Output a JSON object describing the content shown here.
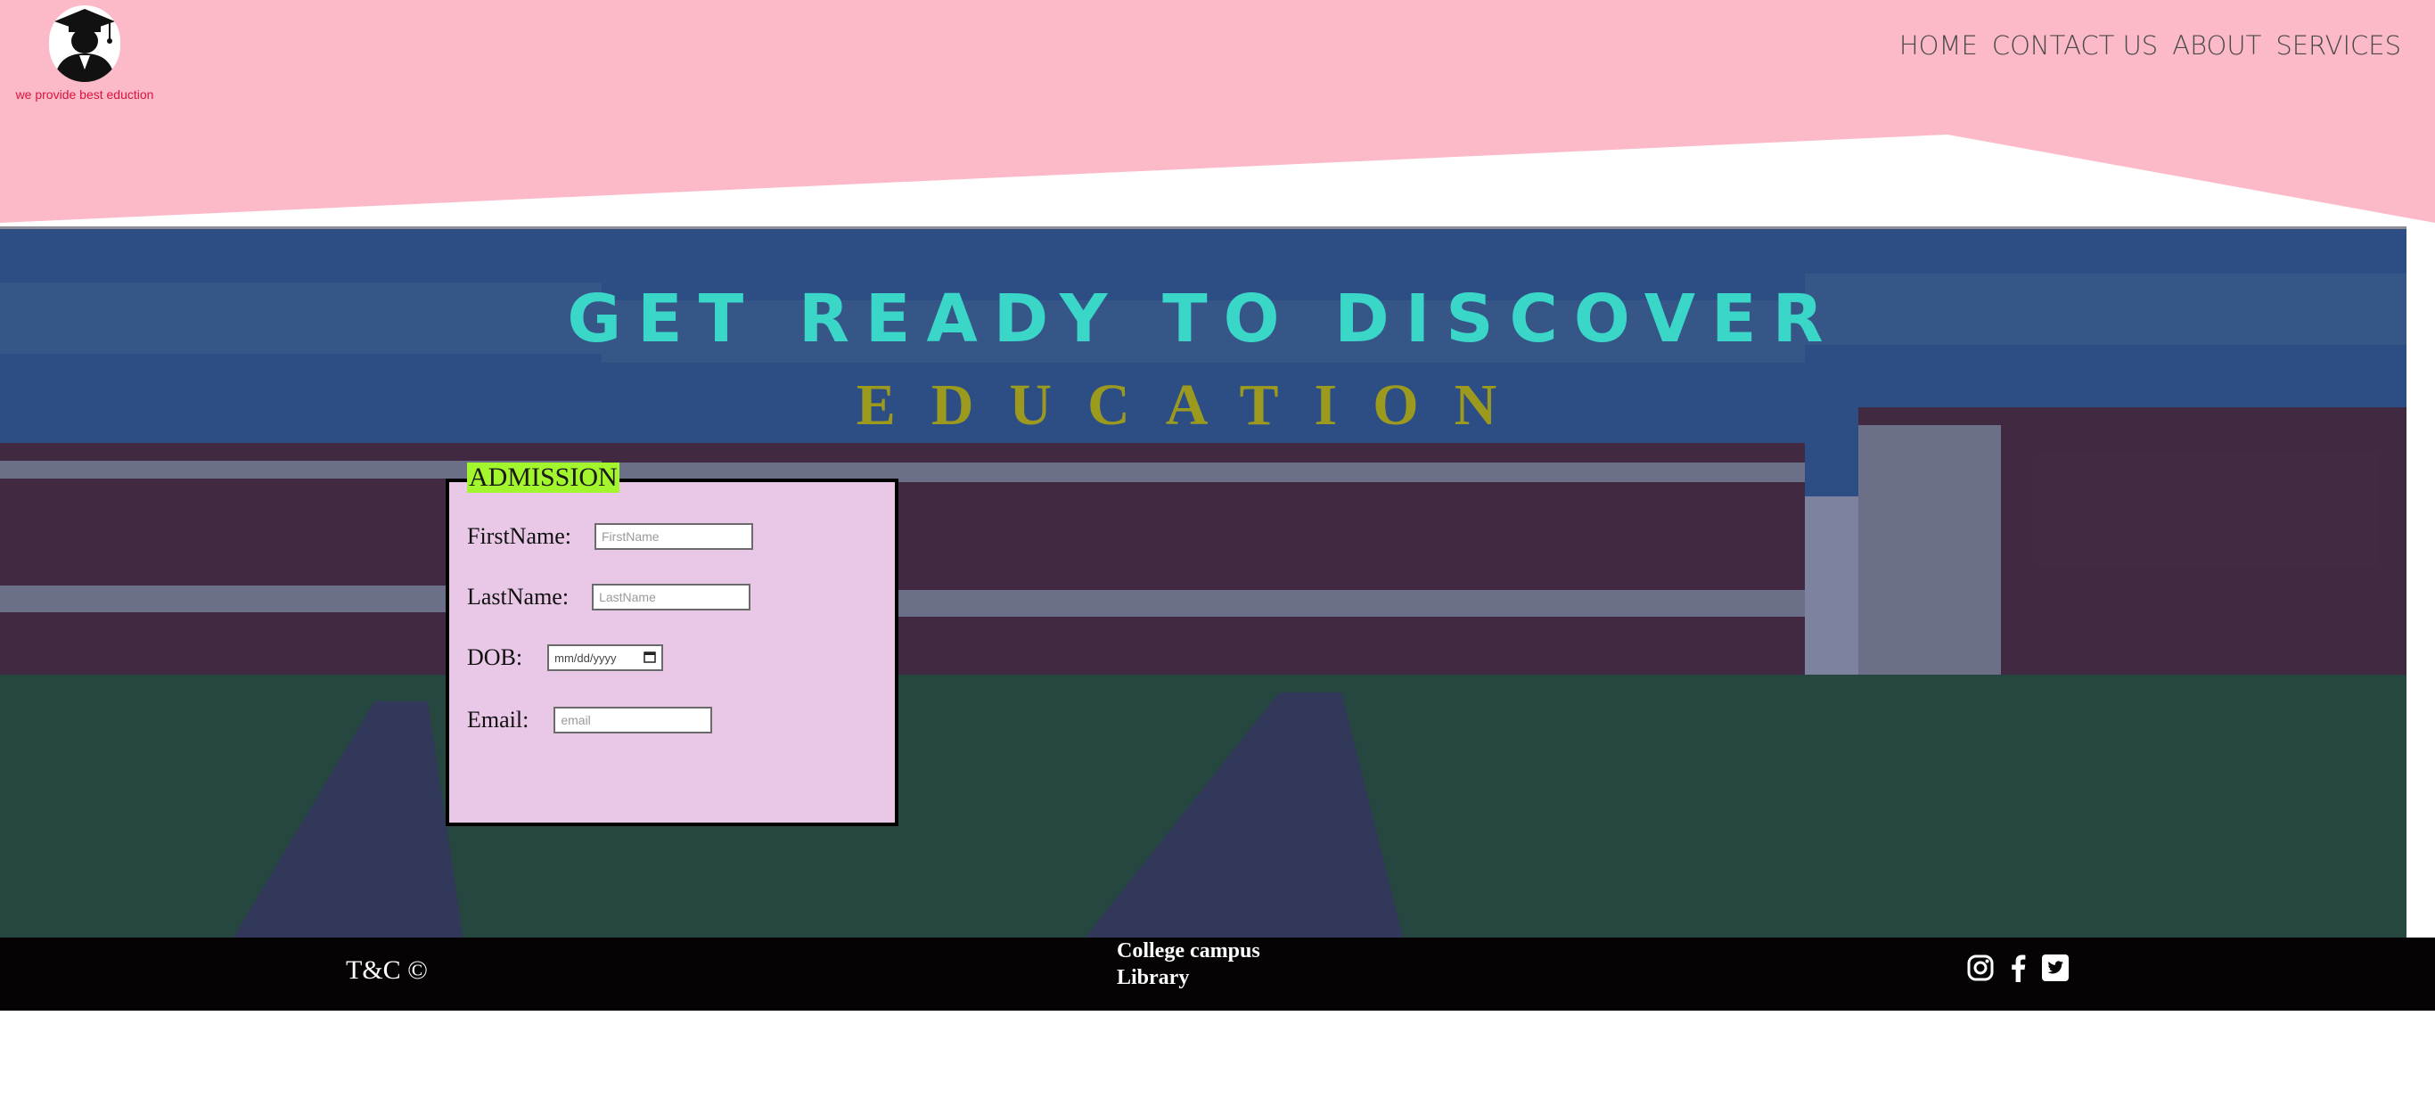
{
  "brand": {
    "tagline": "we provide best eduction"
  },
  "nav": {
    "items": [
      "HOME",
      "CONTACT US",
      "ABOUT",
      "SERVICES"
    ]
  },
  "hero": {
    "title": "GET READY TO DISCOVER",
    "subtitle": "EDUCATION"
  },
  "admission": {
    "legend": "ADMISSION",
    "fields": {
      "first_name": {
        "label": "FirstName:",
        "placeholder": "FirstName"
      },
      "last_name": {
        "label": "LastName:",
        "placeholder": "LastName"
      },
      "dob": {
        "label": "DOB:",
        "placeholder": "mm/dd/yyyy"
      },
      "email": {
        "label": "Email:",
        "placeholder": "email"
      }
    }
  },
  "footer": {
    "left": "T&C ©",
    "links": [
      "College campus",
      "Library"
    ],
    "social_icons": [
      "instagram-icon",
      "facebook-icon",
      "twitter-icon"
    ]
  },
  "colors": {
    "header_bg": "#fcb9c8",
    "hero_title": "#3ad6c8",
    "hero_subtitle": "#9c9a1e",
    "form_bg": "#e8c8e6",
    "legend_bg": "#a3f52d",
    "footer_bg": "#050303"
  }
}
